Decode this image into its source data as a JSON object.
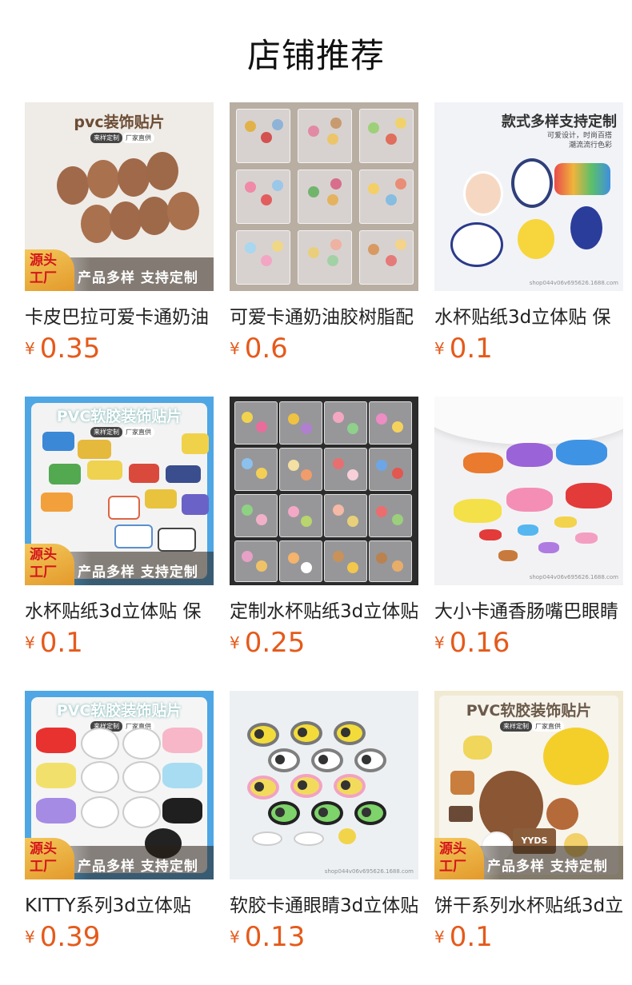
{
  "header": {
    "title": "店铺推荐"
  },
  "currency": "¥",
  "products": [
    {
      "name": "卡皮巴拉可爱卡通奶油",
      "price": "0.35",
      "image": {
        "title": "pvc装饰贴片",
        "chips": [
          "来样定制",
          "厂家直供"
        ],
        "badge_left": [
          "源头",
          "工厂"
        ],
        "badge_text": "产品多样 支持定制"
      }
    },
    {
      "name": "可爱卡通奶油胶树脂配",
      "price": "0.6",
      "image": {}
    },
    {
      "name": "水杯贴纸3d立体贴 保",
      "price": "0.1",
      "image": {
        "title": "款式多样支持定制",
        "subtitle": "可爱设计，时尚百搭",
        "subtitle2": "潮流流行色彩",
        "watermark": "shop044v06v695626.1688.com"
      }
    },
    {
      "name": "水杯贴纸3d立体贴 保",
      "price": "0.1",
      "image": {
        "title": "PVC软胶装饰贴片",
        "chips": [
          "来样定制",
          "厂家直供"
        ],
        "badge_left": [
          "源头",
          "工厂"
        ],
        "badge_text": "产品多样 支持定制"
      }
    },
    {
      "name": "定制水杯贴纸3d立体贴",
      "price": "0.25",
      "image": {}
    },
    {
      "name": "大小卡通香肠嘴巴眼睛",
      "price": "0.16",
      "image": {
        "watermark": "shop044v06v695626.1688.com"
      }
    },
    {
      "name": "KITTY系列3d立体贴",
      "price": "0.39",
      "image": {
        "title": "PVC软胶装饰贴片",
        "chips": [
          "来样定制",
          "厂家直供"
        ],
        "badge_left": [
          "源头",
          "工厂"
        ],
        "badge_text": "产品多样 支持定制"
      }
    },
    {
      "name": "软胶卡通眼睛3d立体贴",
      "price": "0.13",
      "image": {
        "watermark": "shop044v06v695626.1688.com"
      }
    },
    {
      "name": "饼干系列水杯贴纸3d立",
      "price": "0.1",
      "image": {
        "title": "PVC软胶装饰贴片",
        "chips": [
          "来样定制",
          "厂家直供"
        ],
        "badge_left": [
          "源头",
          "工厂"
        ],
        "badge_text": "产品多样 支持定制",
        "sticker_text": "YYDS"
      }
    }
  ]
}
